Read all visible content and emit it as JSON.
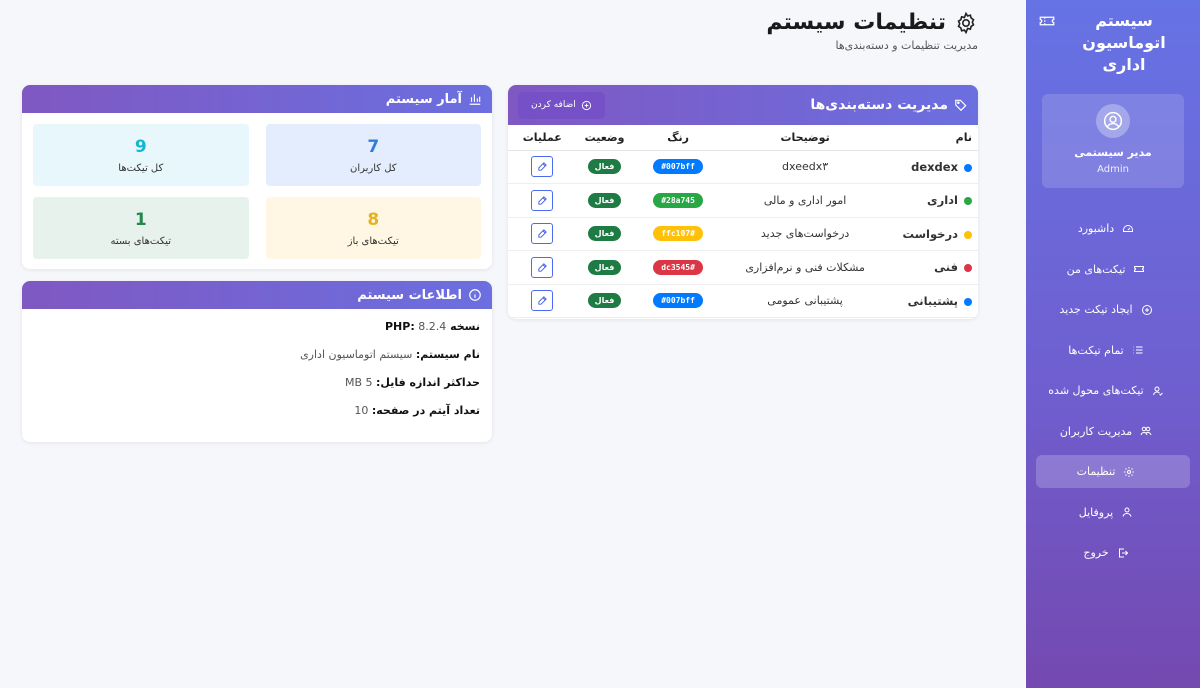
{
  "sidebar": {
    "title": "سیستم اتوماسیون اداری",
    "user": {
      "name": "مدیر سیستمی",
      "role": "Admin"
    },
    "items": [
      {
        "label": "داشبورد",
        "icon": "dashboard-icon"
      },
      {
        "label": "تیکت‌های من",
        "icon": "ticket-icon"
      },
      {
        "label": "ایجاد تیکت جدید",
        "icon": "plus-circle-icon"
      },
      {
        "label": "تمام تیکت‌ها",
        "icon": "list-icon"
      },
      {
        "label": "تیکت‌های محول شده",
        "icon": "user-check-icon"
      },
      {
        "label": "مدیریت کاربران",
        "icon": "users-icon"
      },
      {
        "label": "تنظیمات",
        "icon": "gear-icon",
        "active": true
      },
      {
        "label": "پروفایل",
        "icon": "user-icon"
      },
      {
        "label": "خروج",
        "icon": "logout-icon"
      }
    ]
  },
  "header": {
    "title": "تنظیمات سیستم",
    "subtitle": "مدیریت تنظیمات و دسته‌بندی‌ها"
  },
  "categories": {
    "title": "مدیریت دسته‌بندی‌ها",
    "add_label": "اضافه کردن",
    "columns": {
      "name": "نام",
      "desc": "توضیحات",
      "color": "رنگ",
      "status": "وضعیت",
      "ops": "عملیات"
    },
    "rows": [
      {
        "name": "dexdex",
        "desc": "dxeedx۳",
        "color": "#007bff",
        "status": "فعال"
      },
      {
        "name": "اداری",
        "desc": "امور اداری و مالی",
        "color": "#28a745",
        "status": "فعال"
      },
      {
        "name": "درخواست",
        "desc": "درخواست‌های جدید",
        "color": "#ffc107",
        "status": "فعال"
      },
      {
        "name": "فنی",
        "desc": "مشکلات فنی و نرم‌افزاری",
        "color": "#dc3545",
        "status": "فعال"
      },
      {
        "name": "پشتیبانی",
        "desc": "پشتیبانی عمومی",
        "color": "#007bff",
        "status": "فعال"
      }
    ]
  },
  "stats": {
    "title": "آمار سیستم",
    "items": [
      {
        "value": "7",
        "label": "کل کاربران",
        "color": "#2f7dd6",
        "bg": "#e4edfd"
      },
      {
        "value": "9",
        "label": "کل تیکت‌ها",
        "color": "#17b6cf",
        "bg": "#e7f7fb"
      },
      {
        "value": "8",
        "label": "تیکت‌های باز",
        "color": "#e8b21f",
        "bg": "#fff7e3"
      },
      {
        "value": "1",
        "label": "تیکت‌های بسته",
        "color": "#23884f",
        "bg": "#e8f2ec"
      }
    ]
  },
  "info": {
    "title": "اطلاعات سیستم",
    "rows": [
      {
        "label": "نسخه PHP:",
        "value": "8.2.4"
      },
      {
        "label": "نام سیستم:",
        "value": "سیستم اتوماسیون اداری"
      },
      {
        "label": "حداکثر اندازه فایل:",
        "value": "5 MB"
      },
      {
        "label": "تعداد آیتم در صفحه:",
        "value": "10"
      }
    ]
  }
}
